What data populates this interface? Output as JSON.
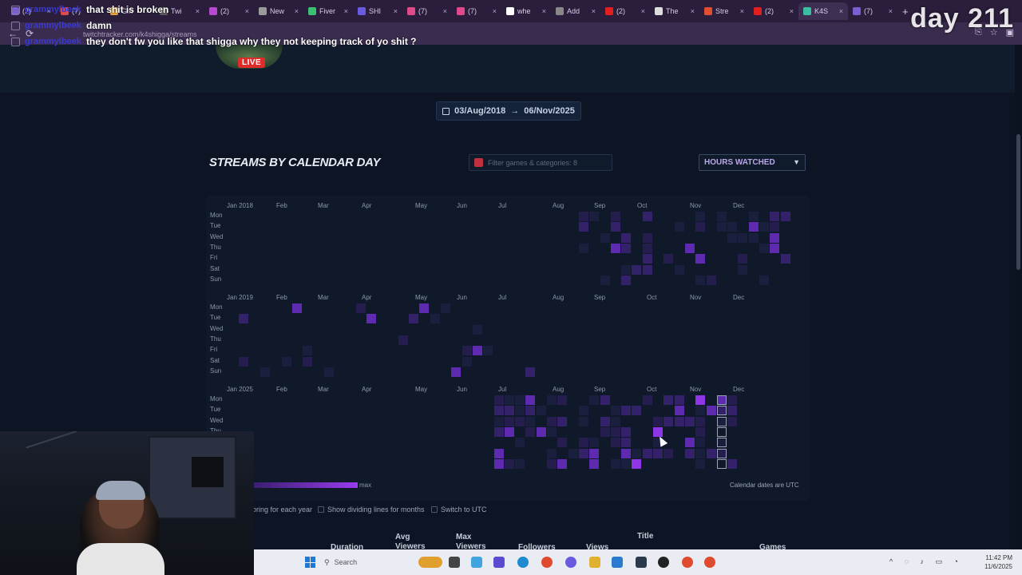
{
  "browser": {
    "tabs": [
      {
        "label": "(2)",
        "color": "#7a5fd0"
      },
      {
        "label": "(7)",
        "color": "#e04a4a"
      },
      {
        "label": "Gm",
        "color": "#e8a23a"
      },
      {
        "label": "Twi",
        "color": "#5a5a5a"
      },
      {
        "label": "(2) ",
        "color": "#b54ad0"
      },
      {
        "label": "New",
        "color": "#9a9a9a"
      },
      {
        "label": "Fiver",
        "color": "#3ac070"
      },
      {
        "label": "SHI",
        "color": "#6a5ae0"
      },
      {
        "label": "(7)",
        "color": "#e04a8a"
      },
      {
        "label": "(7)",
        "color": "#e04a8a"
      },
      {
        "label": "whe",
        "color": "#ffffff"
      },
      {
        "label": "Add",
        "color": "#888888"
      },
      {
        "label": "(2)",
        "color": "#e02020"
      },
      {
        "label": "The",
        "color": "#dddddd"
      },
      {
        "label": "Stre",
        "color": "#e05030"
      },
      {
        "label": "(2)",
        "color": "#e02020"
      },
      {
        "label": "K4S",
        "color": "#3ac0a0"
      },
      {
        "label": "(7)",
        "color": "#7a5fd0"
      }
    ],
    "active_tab_index": 16,
    "new_tab": "+",
    "url": "twitchtracker.com/k4shigga/streams"
  },
  "chat": [
    {
      "user": "grammylbeek",
      "message": "that shit is broken"
    },
    {
      "user": "grammylbeek",
      "message": "damn"
    },
    {
      "user": "grammylbeek",
      "message": "they don't fw you like that shigga why they not keeping track of yo shit ?"
    }
  ],
  "overlay": {
    "day_counter": "day 211"
  },
  "channel": {
    "live_label": "LIVE"
  },
  "date_range": {
    "from": "03/Aug/2018",
    "arrow": "→",
    "to": "06/Nov/2025"
  },
  "section": {
    "title": "STREAMS BY CALENDAR DAY",
    "filter_placeholder": "Filter games & categories: 8",
    "metric_select": "HOURS WATCHED"
  },
  "calendar": {
    "day_labels": [
      "Mon",
      "Tue",
      "Wed",
      "Thu",
      "Fri",
      "Sat",
      "Sun"
    ],
    "years": [
      {
        "months": [
          "Jan 2018",
          "Feb",
          "Mar",
          "Apr",
          "May",
          "Jun",
          "Jul",
          "Aug",
          "Sep",
          "Oct",
          "Nov",
          "Dec"
        ]
      },
      {
        "months": [
          "Jan 2019",
          "Feb",
          "Mar",
          "Apr",
          "May",
          "Jun",
          "Jul",
          "Aug",
          "Sep",
          "Oct",
          "Nov",
          "Dec"
        ]
      },
      {
        "months": [
          "Jan 2025",
          "Feb",
          "Mar",
          "Apr",
          "May",
          "Jun",
          "Jul",
          "Aug",
          "Sep",
          "Oct",
          "Nov",
          "Dec"
        ]
      }
    ],
    "legend_max": "max",
    "utc_note": "Calendar dates are UTC"
  },
  "options": {
    "opt1": "oring for each year",
    "opt2": "Show dividing lines for months",
    "opt3": "Switch to UTC"
  },
  "table_headers": {
    "duration": "Duration",
    "avg_viewers": "Avg Viewers",
    "max_viewers": "Max Viewers",
    "followers": "Followers",
    "views": "Views",
    "title": "Title",
    "games": "Games"
  },
  "taskbar": {
    "search": "Search",
    "time": "11:42 PM",
    "date": "11/6/2025"
  }
}
